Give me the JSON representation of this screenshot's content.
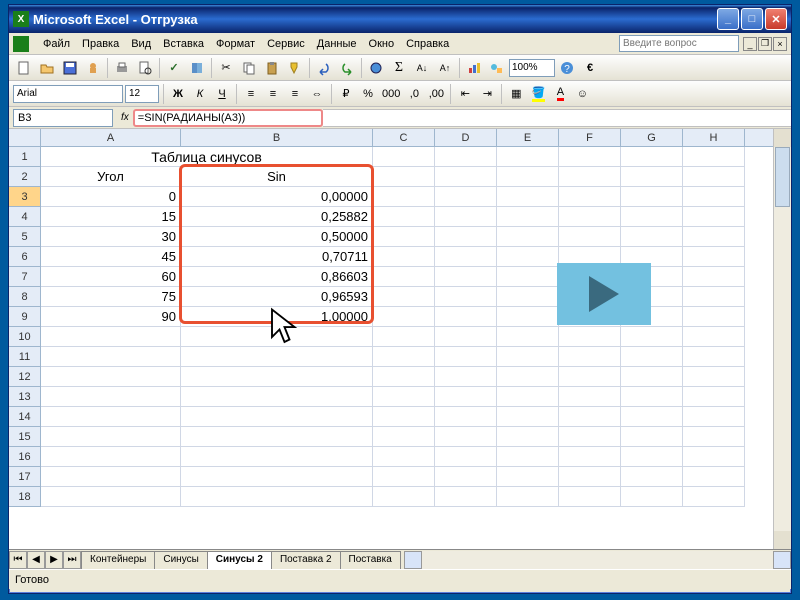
{
  "title": "Microsoft Excel - Отгрузка",
  "menu": [
    "Файл",
    "Правка",
    "Вид",
    "Вставка",
    "Формат",
    "Сервис",
    "Данные",
    "Окно",
    "Справка"
  ],
  "question_placeholder": "Введите вопрос",
  "zoom": "100%",
  "font_name": "Arial",
  "font_size": "12",
  "name_box": "B3",
  "formula": "=SIN(РАДИАНЫ(A3))",
  "columns": [
    "A",
    "B",
    "C",
    "D",
    "E",
    "F",
    "G",
    "H"
  ],
  "sheet_title": "Таблица синусов",
  "col_headers": {
    "A": "Угол",
    "B": "Sin"
  },
  "rows": [
    {
      "n": "1"
    },
    {
      "n": "2"
    },
    {
      "n": "3"
    },
    {
      "n": "4"
    },
    {
      "n": "5"
    },
    {
      "n": "6"
    },
    {
      "n": "7"
    },
    {
      "n": "8"
    },
    {
      "n": "9"
    },
    {
      "n": "10"
    },
    {
      "n": "11"
    },
    {
      "n": "12"
    },
    {
      "n": "13"
    },
    {
      "n": "14"
    },
    {
      "n": "15"
    },
    {
      "n": "16"
    },
    {
      "n": "17"
    },
    {
      "n": "18"
    }
  ],
  "data": [
    {
      "a": "0",
      "b": "0,00000"
    },
    {
      "a": "15",
      "b": "0,25882"
    },
    {
      "a": "30",
      "b": "0,50000"
    },
    {
      "a": "45",
      "b": "0,70711"
    },
    {
      "a": "60",
      "b": "0,86603"
    },
    {
      "a": "75",
      "b": "0,96593"
    },
    {
      "a": "90",
      "b": "1,00000"
    }
  ],
  "tabs": [
    "Контейнеры",
    "Синусы",
    "Синусы 2",
    "Поставка 2",
    "Поставка"
  ],
  "active_tab": 2,
  "status": "Готово"
}
